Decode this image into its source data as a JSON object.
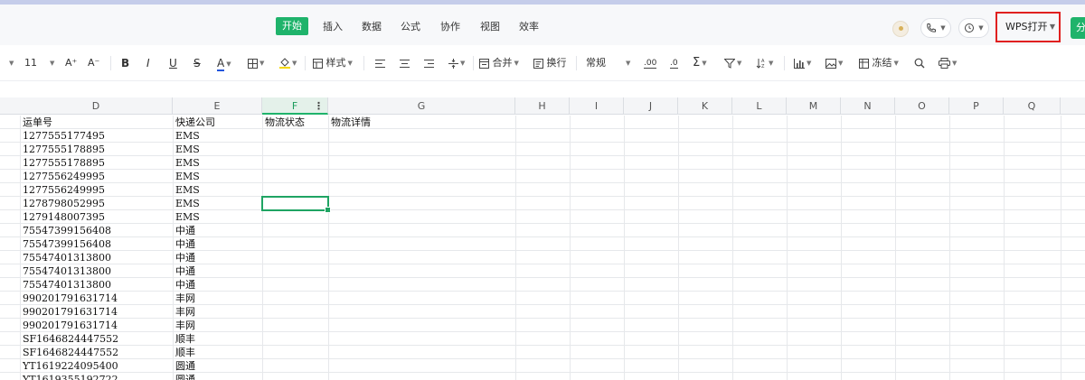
{
  "menu": {
    "tabs": [
      "开始",
      "插入",
      "数据",
      "公式",
      "协作",
      "视图",
      "效率"
    ],
    "active_index": 0
  },
  "top_right": {
    "wps_open_label": "WPS打开",
    "share_label": "分"
  },
  "toolbar": {
    "font_size": "11",
    "grow_font": "A⁺",
    "shrink_font": "A⁻",
    "bold": "B",
    "italic": "I",
    "underline": "U",
    "strike": "S",
    "font_color": "A",
    "style_label": "样式",
    "merge_label": "合并",
    "wrap_label": "换行",
    "number_format": "常规",
    "decimal_add": ".00",
    "decimal_remove": ".0",
    "sum": "Σ",
    "freeze_label": "冻结"
  },
  "colors": {
    "accent": "#1fb36b",
    "highlight_border": "#e02020"
  },
  "sheet": {
    "columns": [
      "D",
      "E",
      "F",
      "G",
      "H",
      "I",
      "J",
      "K",
      "L",
      "M",
      "N",
      "O",
      "P",
      "Q"
    ],
    "selected_column": "F",
    "header_row": [
      "运单号",
      "快递公司",
      "物流状态",
      "物流详情"
    ],
    "rows": [
      [
        "1277555177495",
        "EMS"
      ],
      [
        "1277555178895",
        "EMS"
      ],
      [
        "1277555178895",
        "EMS"
      ],
      [
        "1277556249995",
        "EMS"
      ],
      [
        "1277556249995",
        "EMS"
      ],
      [
        "1278798052995",
        "EMS"
      ],
      [
        "1279148007395",
        "EMS"
      ],
      [
        "75547399156408",
        "中通"
      ],
      [
        "75547399156408",
        "中通"
      ],
      [
        "75547401313800",
        "中通"
      ],
      [
        "75547401313800",
        "中通"
      ],
      [
        "75547401313800",
        "中通"
      ],
      [
        "990201791631714",
        "丰网"
      ],
      [
        "990201791631714",
        "丰网"
      ],
      [
        "990201791631714",
        "丰网"
      ],
      [
        "SF1646824447552",
        "顺丰"
      ],
      [
        "SF1646824447552",
        "顺丰"
      ],
      [
        "YT1619224095400",
        "圆通"
      ],
      [
        "YT1619355192722",
        "圆通"
      ]
    ]
  }
}
